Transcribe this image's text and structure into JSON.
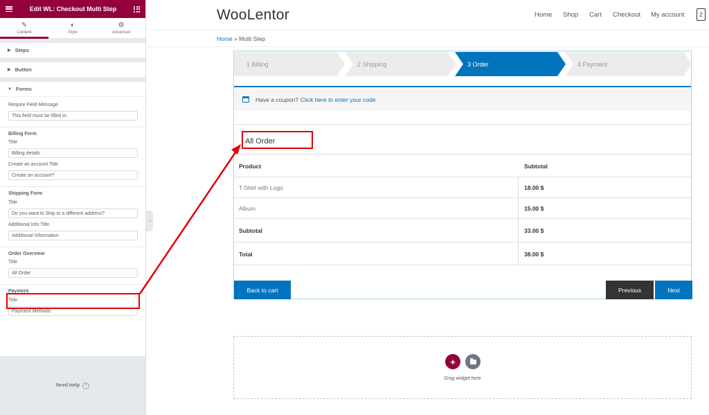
{
  "editor": {
    "title": "Edit WL: Checkout Multi Step",
    "tabs": [
      {
        "label": "Content",
        "icon": "pencil-icon"
      },
      {
        "label": "Style",
        "icon": "contrast-icon"
      },
      {
        "label": "Advanced",
        "icon": "gear-icon"
      }
    ],
    "sections": {
      "steps": "Steps",
      "button": "Button",
      "forms": "Forms"
    },
    "require_field": {
      "label": "Require Field Message",
      "value": "This field must be filled in."
    },
    "billing": {
      "heading": "Billing Form",
      "title_label": "Title",
      "title_value": "Billing details",
      "account_label": "Create an account Title",
      "account_value": "Create an account?"
    },
    "shipping": {
      "heading": "Shipping Form",
      "title_label": "Title",
      "title_value": "Do you want to Ship to a different address?",
      "info_label": "Additional Info Title",
      "info_value": "Additional Information"
    },
    "order_overview": {
      "heading": "Order Overview",
      "title_label": "Title",
      "title_value": "All Order"
    },
    "payment": {
      "heading": "Payment",
      "title_label": "Title",
      "title_value": "Payment Methods"
    },
    "help": "Need Help"
  },
  "site": {
    "logo": "WooLentor",
    "nav": [
      "Home",
      "Shop",
      "Cart",
      "Checkout",
      "My account"
    ],
    "cart_count": "2",
    "breadcrumb": {
      "home": "Home",
      "separator": "»",
      "current": "Multi Step"
    }
  },
  "checkout": {
    "steps": [
      "1 Billing",
      "2 Shipping",
      "3 Order",
      "4 Payment"
    ],
    "active_step": "3 Order",
    "coupon_text": "Have a coupon?",
    "coupon_link": "Click here to enter your code",
    "order_title": "All Order",
    "table": {
      "headers": [
        "Product",
        "Subtotal"
      ],
      "rows": [
        {
          "product": "T-Shirt with Logo",
          "subtotal": "18.00 $"
        },
        {
          "product": "Album",
          "subtotal": "15.00 $"
        }
      ],
      "subtotal": {
        "label": "Subtotal",
        "value": "33.00 $"
      },
      "total": {
        "label": "Total",
        "value": "38.00 $"
      }
    },
    "buttons": {
      "back": "Back to cart",
      "previous": "Previous",
      "next": "Next"
    }
  },
  "drop_area": {
    "text": "Drag widget here"
  },
  "colors": {
    "brand": "#93003c",
    "accent": "#0274be",
    "annotation": "#e00000",
    "dark_button": "#333333"
  }
}
